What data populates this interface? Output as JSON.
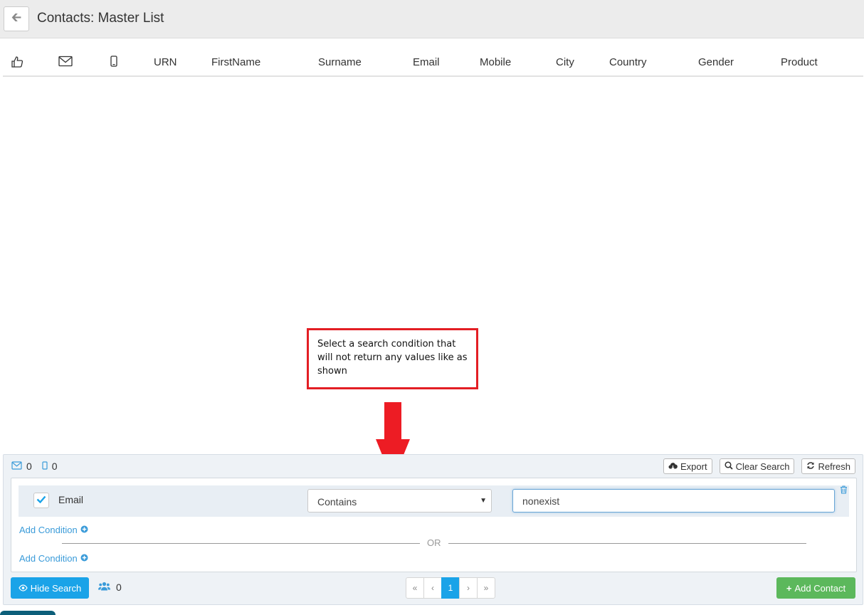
{
  "header": {
    "title": "Contacts: Master List",
    "back_icon": "arrow-left-icon"
  },
  "table": {
    "icon_columns": [
      "thumbs-up-icon",
      "envelope-icon",
      "mobile-icon"
    ],
    "columns": [
      "URN",
      "FirstName",
      "Surname",
      "Email",
      "Mobile",
      "City",
      "Country",
      "Gender",
      "Product"
    ]
  },
  "annotation": {
    "text": "Select a search condition that will not return any values like as shown",
    "border_color": "#e31e24",
    "arrow_color": "#ed1c24"
  },
  "search": {
    "email_count": "0",
    "mobile_count": "0",
    "export_label": "Export",
    "clear_label": "Clear Search",
    "refresh_label": "Refresh",
    "condition": {
      "field": "Email",
      "operator": "Contains",
      "value": "nonexist"
    },
    "add_condition_label": "Add Condition",
    "or_label": "OR",
    "hide_search_label": "Hide Search",
    "contacts_count": "0",
    "pagination": [
      "«",
      "‹",
      "1",
      "›",
      "»"
    ],
    "current_page": "1",
    "add_contact_label": "Add Contact"
  },
  "colors": {
    "accent": "#1aa3e8",
    "success": "#5cb85c",
    "link": "#3a9bd9"
  }
}
